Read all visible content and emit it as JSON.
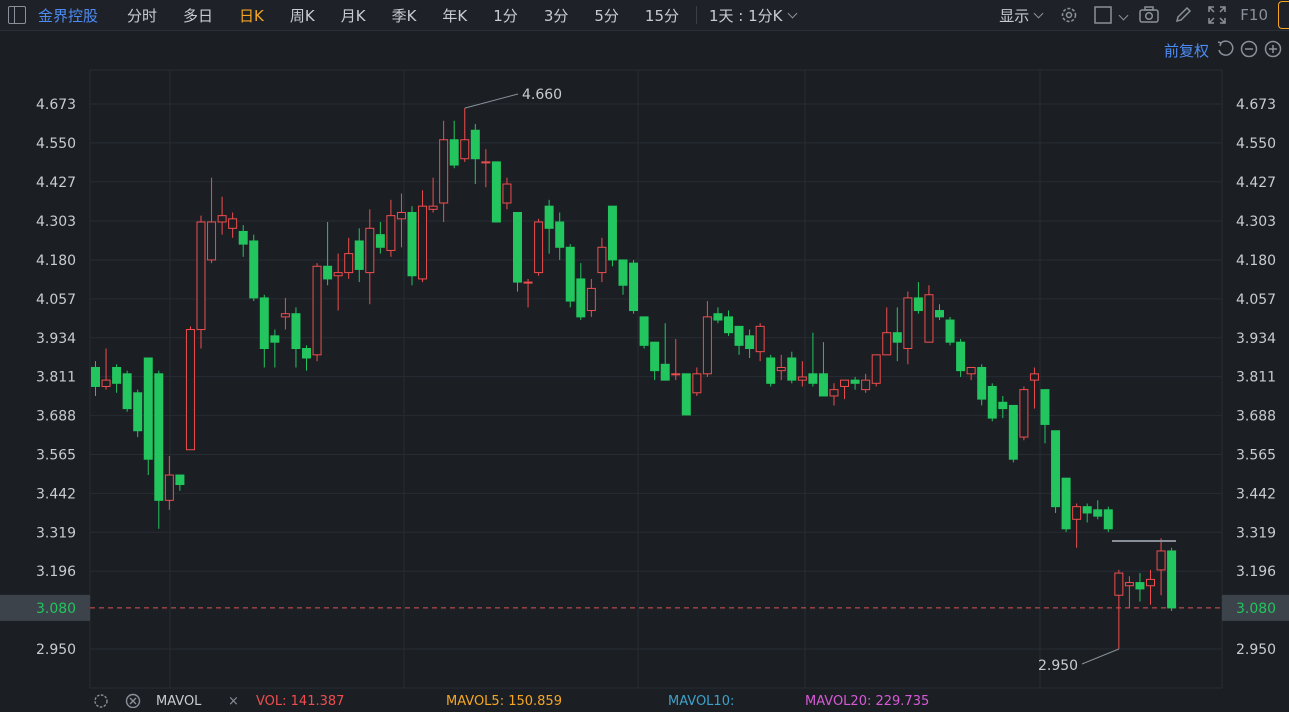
{
  "toolbar": {
    "stock_name": "金界控股",
    "tabs": [
      "分时",
      "多日",
      "日K",
      "周K",
      "月K",
      "季K",
      "年K",
      "1分",
      "3分",
      "5分",
      "15分"
    ],
    "active_tab": "日K",
    "period_combo": "1天 : 1分K",
    "display_label": "显示",
    "f10_label": "F10",
    "accent_color": "#f5a623",
    "link_color": "#4d8bf5"
  },
  "subbar": {
    "adjust_label": "前复权"
  },
  "price_axis": {
    "ticks": [
      "4.673",
      "4.550",
      "4.427",
      "4.303",
      "4.180",
      "4.057",
      "3.934",
      "3.811",
      "3.688",
      "3.565",
      "3.442",
      "3.319",
      "3.196",
      "2.950"
    ],
    "current_price": "3.080",
    "current_price_bg": "#3c434b"
  },
  "annotations": {
    "high": "4.660",
    "low": "2.950"
  },
  "colors": {
    "up": "#ef4d4d",
    "down": "#22c55e",
    "grid": "#272c33"
  },
  "volume_bar": {
    "label": "MAVOL",
    "vol": "VOL: 141.387",
    "mavol5": "MAVOL5: 150.859",
    "mavol10": "MAVOL10:",
    "mavol20": "MAVOL20: 229.735",
    "vol_color": "#ef4d4d",
    "mavol5_color": "#f5a623",
    "mavol10_color": "#3fa0c8",
    "mavol20_color": "#d65ad6"
  },
  "chart_data": {
    "type": "candlestick",
    "y_range": [
      2.87,
      4.75
    ],
    "candles": [
      {
        "o": 3.84,
        "c": 3.78,
        "h": 3.86,
        "l": 3.75
      },
      {
        "o": 3.78,
        "c": 3.8,
        "h": 3.9,
        "l": 3.77
      },
      {
        "o": 3.84,
        "c": 3.79,
        "h": 3.85,
        "l": 3.76
      },
      {
        "o": 3.82,
        "c": 3.71,
        "h": 3.83,
        "l": 3.7
      },
      {
        "o": 3.76,
        "c": 3.64,
        "h": 3.77,
        "l": 3.62
      },
      {
        "o": 3.87,
        "c": 3.55,
        "h": 3.87,
        "l": 3.5
      },
      {
        "o": 3.82,
        "c": 3.42,
        "h": 3.83,
        "l": 3.33
      },
      {
        "o": 3.42,
        "c": 3.5,
        "h": 3.56,
        "l": 3.39
      },
      {
        "o": 3.5,
        "c": 3.47,
        "h": 3.5,
        "l": 3.45
      },
      {
        "o": 3.58,
        "c": 3.96,
        "h": 3.97,
        "l": 3.58
      },
      {
        "o": 3.96,
        "c": 4.3,
        "h": 4.32,
        "l": 3.9
      },
      {
        "o": 4.18,
        "c": 4.3,
        "h": 4.44,
        "l": 4.17
      },
      {
        "o": 4.3,
        "c": 4.32,
        "h": 4.38,
        "l": 4.26
      },
      {
        "o": 4.28,
        "c": 4.31,
        "h": 4.33,
        "l": 4.25
      },
      {
        "o": 4.27,
        "c": 4.23,
        "h": 4.29,
        "l": 4.19
      },
      {
        "o": 4.24,
        "c": 4.06,
        "h": 4.26,
        "l": 4.05
      },
      {
        "o": 4.06,
        "c": 3.9,
        "h": 4.07,
        "l": 3.84
      },
      {
        "o": 3.94,
        "c": 3.92,
        "h": 3.96,
        "l": 3.84
      },
      {
        "o": 4.0,
        "c": 4.01,
        "h": 4.06,
        "l": 3.96
      },
      {
        "o": 4.01,
        "c": 3.9,
        "h": 4.03,
        "l": 3.84
      },
      {
        "o": 3.9,
        "c": 3.87,
        "h": 3.91,
        "l": 3.83
      },
      {
        "o": 3.88,
        "c": 4.16,
        "h": 4.17,
        "l": 3.86
      },
      {
        "o": 4.16,
        "c": 4.12,
        "h": 4.3,
        "l": 4.1
      },
      {
        "o": 4.13,
        "c": 4.14,
        "h": 4.2,
        "l": 4.02
      },
      {
        "o": 4.14,
        "c": 4.2,
        "h": 4.25,
        "l": 4.12
      },
      {
        "o": 4.24,
        "c": 4.15,
        "h": 4.28,
        "l": 4.11
      },
      {
        "o": 4.14,
        "c": 4.28,
        "h": 4.34,
        "l": 4.04
      },
      {
        "o": 4.26,
        "c": 4.22,
        "h": 4.3,
        "l": 4.2
      },
      {
        "o": 4.21,
        "c": 4.32,
        "h": 4.37,
        "l": 4.19
      },
      {
        "o": 4.31,
        "c": 4.33,
        "h": 4.39,
        "l": 4.22
      },
      {
        "o": 4.33,
        "c": 4.13,
        "h": 4.35,
        "l": 4.1
      },
      {
        "o": 4.12,
        "c": 4.35,
        "h": 4.4,
        "l": 4.11
      },
      {
        "o": 4.34,
        "c": 4.35,
        "h": 4.44,
        "l": 4.33
      },
      {
        "o": 4.36,
        "c": 4.56,
        "h": 4.62,
        "l": 4.3
      },
      {
        "o": 4.56,
        "c": 4.48,
        "h": 4.62,
        "l": 4.47
      },
      {
        "o": 4.5,
        "c": 4.56,
        "h": 4.66,
        "l": 4.49
      },
      {
        "o": 4.59,
        "c": 4.5,
        "h": 4.61,
        "l": 4.42
      },
      {
        "o": 4.49,
        "c": 4.49,
        "h": 4.53,
        "l": 4.41
      },
      {
        "o": 4.49,
        "c": 4.3,
        "h": 4.49,
        "l": 4.3
      },
      {
        "o": 4.36,
        "c": 4.42,
        "h": 4.44,
        "l": 4.34
      },
      {
        "o": 4.33,
        "c": 4.11,
        "h": 4.33,
        "l": 4.08
      },
      {
        "o": 4.11,
        "c": 4.11,
        "h": 4.12,
        "l": 4.03
      },
      {
        "o": 4.14,
        "c": 4.3,
        "h": 4.31,
        "l": 4.13
      },
      {
        "o": 4.35,
        "c": 4.28,
        "h": 4.37,
        "l": 4.2
      },
      {
        "o": 4.3,
        "c": 4.22,
        "h": 4.33,
        "l": 4.18
      },
      {
        "o": 4.22,
        "c": 4.05,
        "h": 4.23,
        "l": 4.03
      },
      {
        "o": 4.12,
        "c": 4.0,
        "h": 4.17,
        "l": 3.99
      },
      {
        "o": 4.02,
        "c": 4.09,
        "h": 4.12,
        "l": 4.0
      },
      {
        "o": 4.14,
        "c": 4.22,
        "h": 4.25,
        "l": 4.11
      },
      {
        "o": 4.35,
        "c": 4.18,
        "h": 4.35,
        "l": 4.16
      },
      {
        "o": 4.18,
        "c": 4.1,
        "h": 4.18,
        "l": 4.07
      },
      {
        "o": 4.17,
        "c": 4.02,
        "h": 4.18,
        "l": 4.01
      },
      {
        "o": 4.0,
        "c": 3.91,
        "h": 4.0,
        "l": 3.9
      },
      {
        "o": 3.92,
        "c": 3.83,
        "h": 3.92,
        "l": 3.8
      },
      {
        "o": 3.85,
        "c": 3.8,
        "h": 3.98,
        "l": 3.8
      },
      {
        "o": 3.82,
        "c": 3.82,
        "h": 3.93,
        "l": 3.8
      },
      {
        "o": 3.82,
        "c": 3.69,
        "h": 3.82,
        "l": 3.69
      },
      {
        "o": 3.76,
        "c": 3.82,
        "h": 3.84,
        "l": 3.75
      },
      {
        "o": 3.82,
        "c": 4.0,
        "h": 4.05,
        "l": 3.81
      },
      {
        "o": 4.01,
        "c": 3.99,
        "h": 4.03,
        "l": 3.98
      },
      {
        "o": 4.0,
        "c": 3.95,
        "h": 4.02,
        "l": 3.94
      },
      {
        "o": 3.97,
        "c": 3.91,
        "h": 3.97,
        "l": 3.88
      },
      {
        "o": 3.94,
        "c": 3.9,
        "h": 3.96,
        "l": 3.87
      },
      {
        "o": 3.89,
        "c": 3.97,
        "h": 3.98,
        "l": 3.86
      },
      {
        "o": 3.87,
        "c": 3.79,
        "h": 3.88,
        "l": 3.78
      },
      {
        "o": 3.83,
        "c": 3.84,
        "h": 3.88,
        "l": 3.8
      },
      {
        "o": 3.87,
        "c": 3.8,
        "h": 3.89,
        "l": 3.79
      },
      {
        "o": 3.8,
        "c": 3.81,
        "h": 3.86,
        "l": 3.78
      },
      {
        "o": 3.82,
        "c": 3.79,
        "h": 3.95,
        "l": 3.78
      },
      {
        "o": 3.82,
        "c": 3.75,
        "h": 3.92,
        "l": 3.75
      },
      {
        "o": 3.75,
        "c": 3.77,
        "h": 3.79,
        "l": 3.72
      },
      {
        "o": 3.78,
        "c": 3.8,
        "h": 3.8,
        "l": 3.74
      },
      {
        "o": 3.8,
        "c": 3.79,
        "h": 3.81,
        "l": 3.77
      },
      {
        "o": 3.77,
        "c": 3.8,
        "h": 3.82,
        "l": 3.76
      },
      {
        "o": 3.79,
        "c": 3.88,
        "h": 3.88,
        "l": 3.78
      },
      {
        "o": 3.88,
        "c": 3.95,
        "h": 4.03,
        "l": 3.88
      },
      {
        "o": 3.95,
        "c": 3.92,
        "h": 4.03,
        "l": 3.86
      },
      {
        "o": 3.9,
        "c": 4.06,
        "h": 4.08,
        "l": 3.85
      },
      {
        "o": 4.06,
        "c": 4.02,
        "h": 4.11,
        "l": 4.01
      },
      {
        "o": 3.92,
        "c": 4.07,
        "h": 4.1,
        "l": 3.92
      },
      {
        "o": 4.02,
        "c": 4.0,
        "h": 4.04,
        "l": 3.99
      },
      {
        "o": 3.99,
        "c": 3.92,
        "h": 4.0,
        "l": 3.91
      },
      {
        "o": 3.92,
        "c": 3.83,
        "h": 3.93,
        "l": 3.81
      },
      {
        "o": 3.82,
        "c": 3.84,
        "h": 3.84,
        "l": 3.8
      },
      {
        "o": 3.84,
        "c": 3.74,
        "h": 3.85,
        "l": 3.72
      },
      {
        "o": 3.78,
        "c": 3.68,
        "h": 3.79,
        "l": 3.67
      },
      {
        "o": 3.73,
        "c": 3.71,
        "h": 3.75,
        "l": 3.68
      },
      {
        "o": 3.72,
        "c": 3.55,
        "h": 3.72,
        "l": 3.54
      },
      {
        "o": 3.62,
        "c": 3.77,
        "h": 3.78,
        "l": 3.61
      },
      {
        "o": 3.8,
        "c": 3.82,
        "h": 3.84,
        "l": 3.71
      },
      {
        "o": 3.77,
        "c": 3.66,
        "h": 3.77,
        "l": 3.6
      },
      {
        "o": 3.64,
        "c": 3.4,
        "h": 3.64,
        "l": 3.38
      },
      {
        "o": 3.49,
        "c": 3.33,
        "h": 3.49,
        "l": 3.32
      },
      {
        "o": 3.36,
        "c": 3.4,
        "h": 3.41,
        "l": 3.27
      },
      {
        "o": 3.4,
        "c": 3.38,
        "h": 3.41,
        "l": 3.35
      },
      {
        "o": 3.39,
        "c": 3.37,
        "h": 3.42,
        "l": 3.36
      },
      {
        "o": 3.39,
        "c": 3.33,
        "h": 3.4,
        "l": 3.32
      },
      {
        "o": 3.12,
        "c": 3.19,
        "h": 3.2,
        "l": 2.95
      },
      {
        "o": 3.15,
        "c": 3.16,
        "h": 3.18,
        "l": 3.08
      },
      {
        "o": 3.16,
        "c": 3.14,
        "h": 3.19,
        "l": 3.1
      },
      {
        "o": 3.15,
        "c": 3.17,
        "h": 3.2,
        "l": 3.09
      },
      {
        "o": 3.2,
        "c": 3.26,
        "h": 3.3,
        "l": 3.12
      },
      {
        "o": 3.26,
        "c": 3.08,
        "h": 3.27,
        "l": 3.07
      }
    ]
  }
}
